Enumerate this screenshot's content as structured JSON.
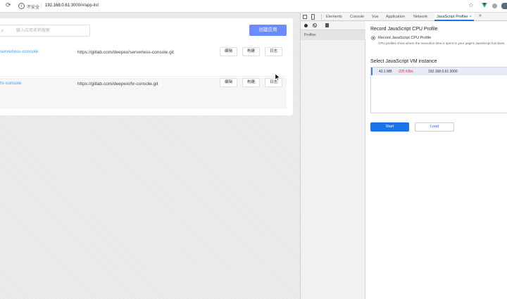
{
  "browser": {
    "not_secure": "不安全",
    "url_host": "192.168.0.61",
    "url_rest": ":3000/#/app-list"
  },
  "app": {
    "search_placeholder": "输入应用名称搜索",
    "create_label": "创建应用",
    "rows": [
      {
        "name": "serverless-console",
        "url": "https://gitlab.com/deepex/serverless-console.git",
        "edit": "编辑",
        "build": "构建",
        "log": "日志"
      },
      {
        "name": "hr-console",
        "url": "https://gitlab.com/deepexi/hr-console.git",
        "edit": "编辑",
        "build": "构建",
        "log": "日志"
      }
    ]
  },
  "devtools": {
    "tabs": [
      "Elements",
      "Console",
      "Vue",
      "Application",
      "Network",
      "JavaScript Profiler"
    ],
    "active_tab": "JavaScript Profiler",
    "side_label": "Profiles",
    "title": "Record JavaScript CPU Profile",
    "radio_label": "Record JavaScript CPU Profile",
    "radio_desc": "CPU profiles show where the execution time is spent in your page's JavaScript functions.",
    "vm_title": "Select JavaScript VM instance",
    "vm": {
      "memory": "43.1 MB",
      "rate": "↑225 KB/s",
      "host": "192.168.0.61:3000"
    },
    "start_label": "Start",
    "load_label": "Load"
  },
  "colors": {
    "primary": "#6b8cff",
    "link": "#409eff",
    "devtools_blue": "#1a73e8"
  }
}
